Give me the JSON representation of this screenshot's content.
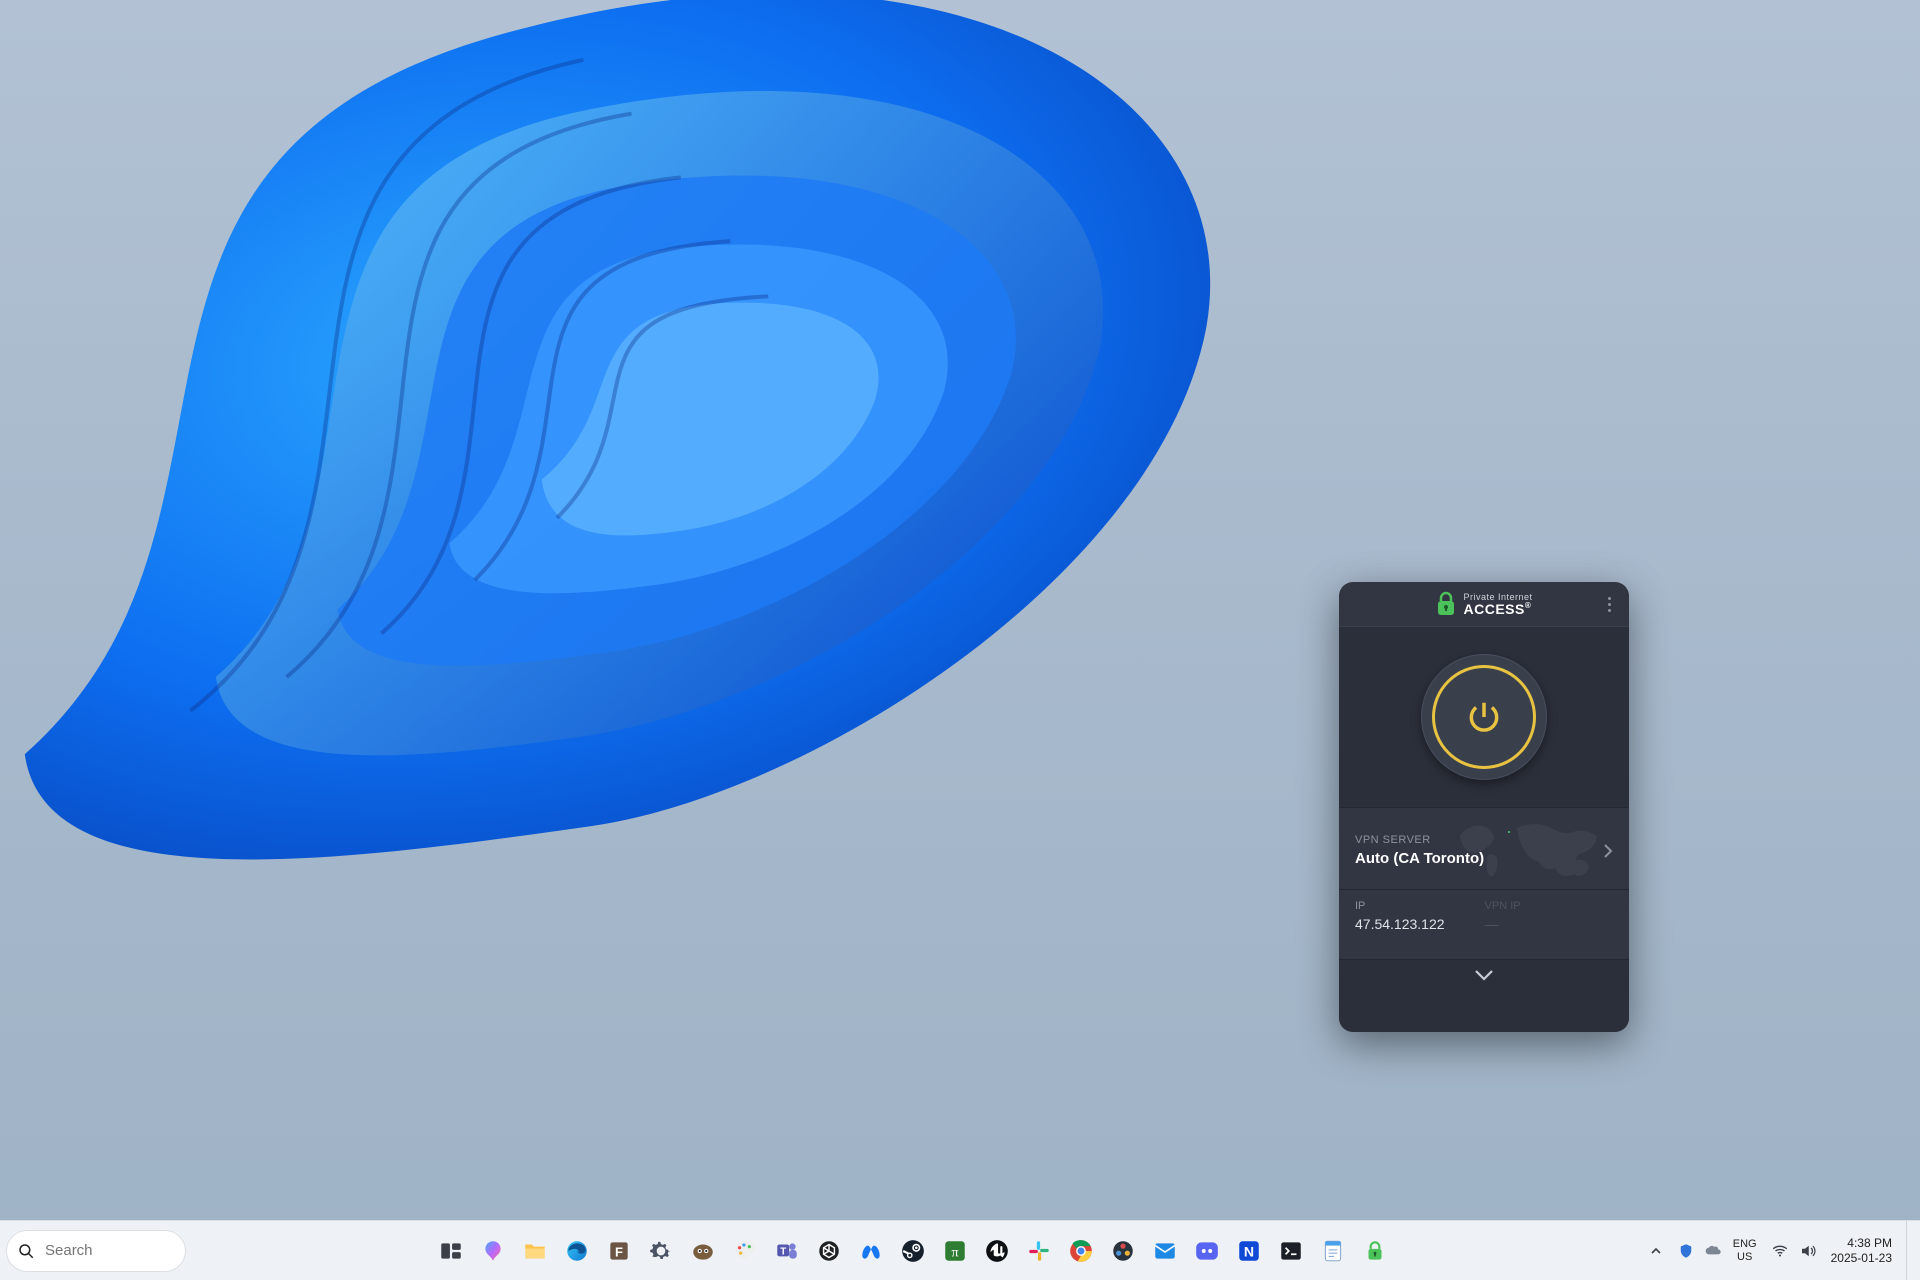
{
  "pia": {
    "logo_top": "Private Internet",
    "logo_bottom": "ACCESS",
    "logo_suffix": "®",
    "server_label": "VPN SERVER",
    "server_value": "Auto (CA Toronto)",
    "ip_label": "IP",
    "ip_value": "47.54.123.122",
    "vpn_ip_label": "VPN IP",
    "vpn_ip_value": "—",
    "accent_color": "#e8c341",
    "logo_green": "#4cc25a"
  },
  "taskbar": {
    "search_placeholder": "Search",
    "apps": [
      {
        "name": "task-view",
        "title": "Task View"
      },
      {
        "name": "copilot",
        "title": "Copilot"
      },
      {
        "name": "file-explorer",
        "title": "File Explorer"
      },
      {
        "name": "edge",
        "title": "Microsoft Edge"
      },
      {
        "name": "figma",
        "title": "F app"
      },
      {
        "name": "settings",
        "title": "Settings"
      },
      {
        "name": "gimp",
        "title": "GIMP"
      },
      {
        "name": "paint",
        "title": "Paint"
      },
      {
        "name": "teams",
        "title": "Microsoft Teams"
      },
      {
        "name": "chatgpt",
        "title": "ChatGPT"
      },
      {
        "name": "meta",
        "title": "Meta"
      },
      {
        "name": "steam",
        "title": "Steam"
      },
      {
        "name": "pi",
        "title": "Pi app"
      },
      {
        "name": "unreal",
        "title": "Unreal Engine"
      },
      {
        "name": "slack",
        "title": "Slack"
      },
      {
        "name": "chrome",
        "title": "Google Chrome"
      },
      {
        "name": "davinci",
        "title": "DaVinci Resolve"
      },
      {
        "name": "mail",
        "title": "Mail"
      },
      {
        "name": "discord",
        "title": "Discord"
      },
      {
        "name": "app-n",
        "title": "N app"
      },
      {
        "name": "terminal",
        "title": "Terminal"
      },
      {
        "name": "notepad",
        "title": "Notepad"
      },
      {
        "name": "pia",
        "title": "Private Internet Access"
      }
    ],
    "tray": {
      "lang_top": "ENG",
      "lang_bottom": "US",
      "time": "4:38 PM",
      "date": "2025-01-23"
    }
  }
}
